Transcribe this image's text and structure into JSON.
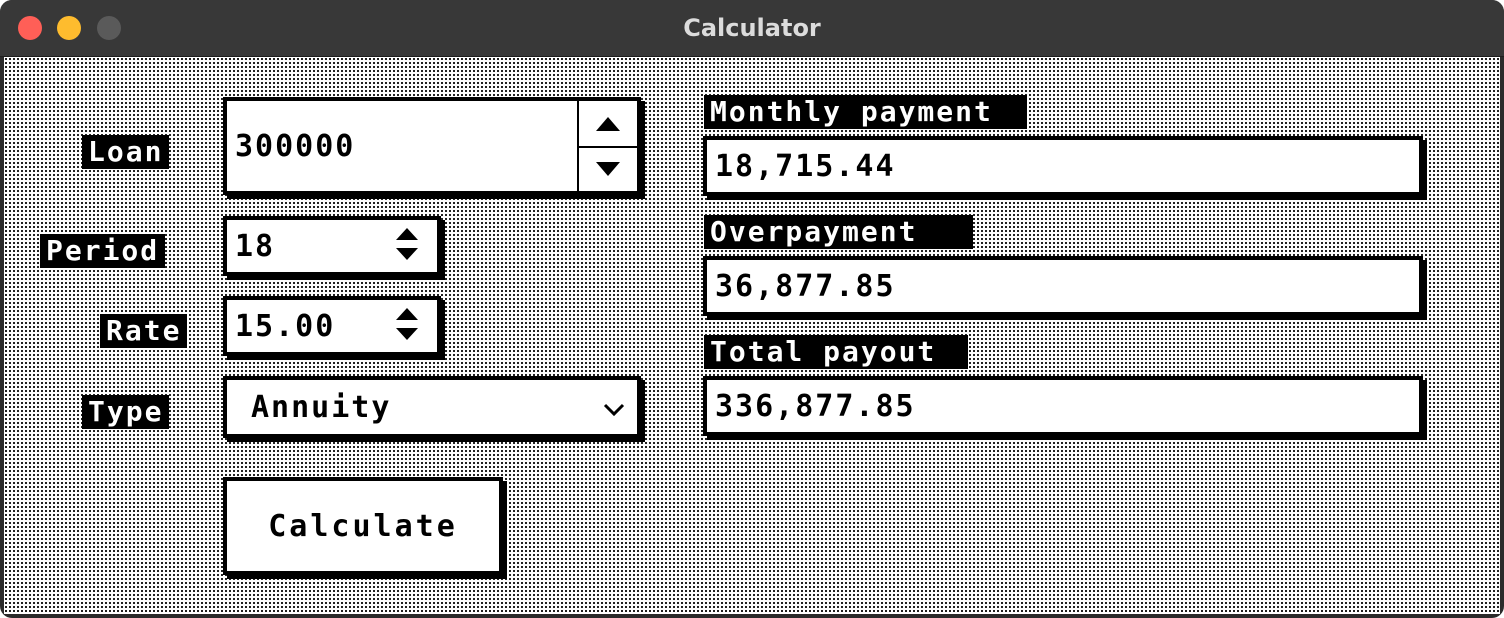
{
  "window": {
    "title": "Calculator"
  },
  "inputs": {
    "loan": {
      "label": "Loan",
      "value": "300000"
    },
    "period": {
      "label": "Period",
      "value": "18"
    },
    "rate": {
      "label": "Rate",
      "value": "15.00"
    },
    "type": {
      "label": "Type",
      "selected": "Annuity"
    }
  },
  "actions": {
    "calculate_label": "Calculate"
  },
  "results": {
    "monthly_payment": {
      "label": "Monthly payment",
      "value": "18,715.44"
    },
    "overpayment": {
      "label": "Overpayment",
      "value": "36,877.85"
    },
    "total_payout": {
      "label": "Total payout",
      "value": "336,877.85"
    }
  },
  "icons": {
    "close": "close-icon",
    "minimize": "minimize-icon",
    "zoom": "zoom-icon",
    "stepper_up": "triangle-up-icon",
    "stepper_down": "triangle-down-icon",
    "dropdown": "chevron-down-icon"
  },
  "colors": {
    "close": "#ff5f57",
    "minimize": "#febc2e",
    "zoom_inactive": "#5a5a5a",
    "titlebar": "#383838",
    "label_bg": "#000000",
    "field_bg": "#ffffff"
  }
}
